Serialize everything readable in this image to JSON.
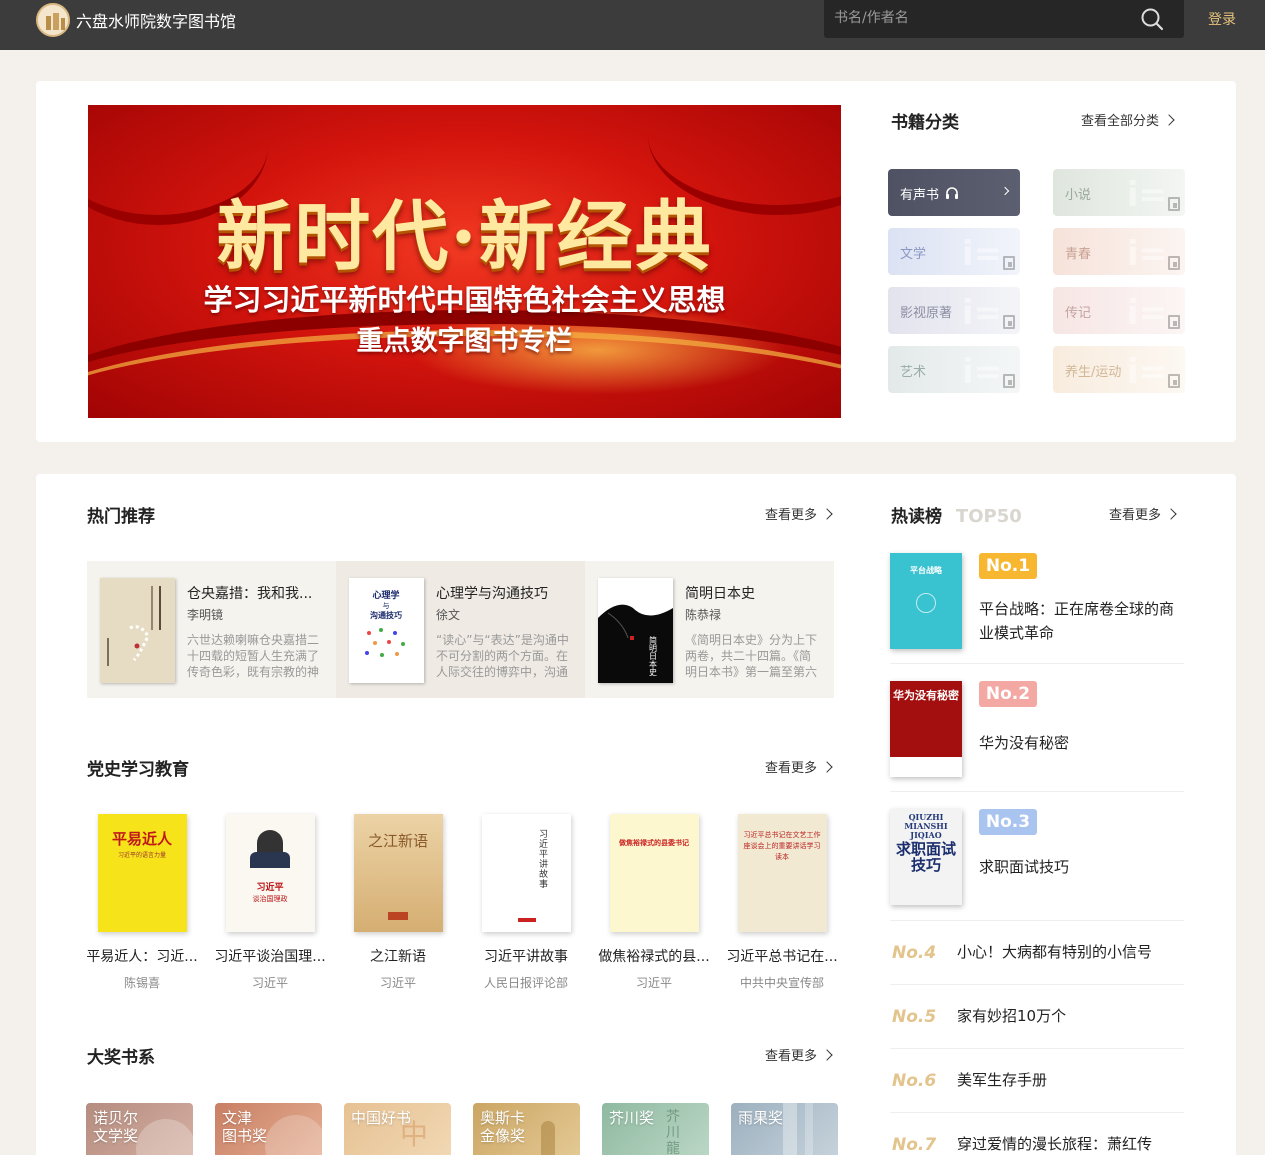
{
  "header": {
    "site_title": "六盘水师院数字图书馆",
    "search_placeholder": "书名/作者名",
    "login_label": "登录"
  },
  "banner": {
    "title": "新时代·新经典",
    "subtitle1": "学习习近平新时代中国特色社会主义思想",
    "subtitle2": "重点数字图书专栏"
  },
  "categories": {
    "title": "书籍分类",
    "more_label": "查看全部分类",
    "items": [
      {
        "label": "有声书",
        "color": "#5b5f70"
      },
      {
        "label": "小说",
        "color": "#dfe6de"
      },
      {
        "label": "文学",
        "color": "#dbe2f3"
      },
      {
        "label": "青春",
        "color": "#f6e3da"
      },
      {
        "label": "影视原著",
        "color": "#e2e3ed"
      },
      {
        "label": "传记",
        "color": "#f6e6e4"
      },
      {
        "label": "艺术",
        "color": "#e3e9e9"
      },
      {
        "label": "养生/运动",
        "color": "#f8ecde"
      }
    ]
  },
  "hot": {
    "title": "热门推荐",
    "more_label": "查看更多",
    "books": [
      {
        "title": "仓央嘉措：我和我...",
        "author": "李明镜",
        "desc": "六世达赖喇嘛仓央嘉措二十四载的短暂人生充满了传奇色彩，既有宗教的神圣、..."
      },
      {
        "title": "心理学与沟通技巧",
        "author": "徐文",
        "desc": "“读心”与“表达”是沟通中不可分割的两个方面。在人际交往的博弈中，沟通能力..."
      },
      {
        "title": "简明日本史",
        "author": "陈恭禄",
        "desc": "《简明日本史》分为上下两卷，共二十四篇。《简明日本书》第一篇至第六篇详..."
      }
    ]
  },
  "party": {
    "title": "党史学习教育",
    "more_label": "查看更多",
    "books": [
      {
        "title": "平易近人：习近...",
        "author": "陈锡喜"
      },
      {
        "title": "习近平谈治国理...",
        "author": "习近平"
      },
      {
        "title": "之江新语",
        "author": "习近平"
      },
      {
        "title": "习近平讲故事",
        "author": "人民日报评论部"
      },
      {
        "title": "做焦裕禄式的县...",
        "author": "习近平"
      },
      {
        "title": "习近平总书记在...",
        "author": "中共中央宣传部"
      }
    ],
    "cover_texts": [
      "平易近人",
      "习近平的语言力量",
      "习近平",
      "谈治国理政",
      "之江新语",
      "习近平讲故事",
      "做焦裕禄式的县委书记",
      "习近平总书记在文艺工作座谈会上的重要讲话学习读本"
    ]
  },
  "awards": {
    "title": "大奖书系",
    "more_label": "查看更多",
    "items": [
      {
        "label": "诺贝尔\n文学奖",
        "color": "#c49b8b"
      },
      {
        "label": "文津\n图书奖",
        "color": "#d79b82"
      },
      {
        "label": "中国好书",
        "color": "#e3c49a"
      },
      {
        "label": "奥斯卡\n金像奖",
        "color": "#d7b57a"
      },
      {
        "label": "芥川奖",
        "color": "#9cc1aa"
      },
      {
        "label": "雨果奖",
        "color": "#aebfca"
      }
    ]
  },
  "ranking": {
    "title": "热读榜",
    "title_suffix": "TOP50",
    "more_label": "查看更多",
    "top": [
      {
        "no": "No.1",
        "title": "平台战略：正在席卷全球的商业模式革命",
        "badge_color": "#f7b731"
      },
      {
        "no": "No.2",
        "title": "华为没有秘密",
        "badge_color": "#f3a8a3"
      },
      {
        "no": "No.3",
        "title": "求职面试技巧",
        "badge_color": "#a9c4ef"
      }
    ],
    "list": [
      {
        "no": "No.4",
        "title": "小心！大病都有特别的小信号"
      },
      {
        "no": "No.5",
        "title": "家有妙招10万个"
      },
      {
        "no": "No.6",
        "title": "美军生存手册"
      },
      {
        "no": "No.7",
        "title": "穿过爱情的漫长旅程：萧红传"
      }
    ],
    "cover_texts": [
      "平台战略",
      "华为没有秘密",
      "QIUZHI MIANSHI JIQIAO",
      "求职面试技巧"
    ]
  }
}
